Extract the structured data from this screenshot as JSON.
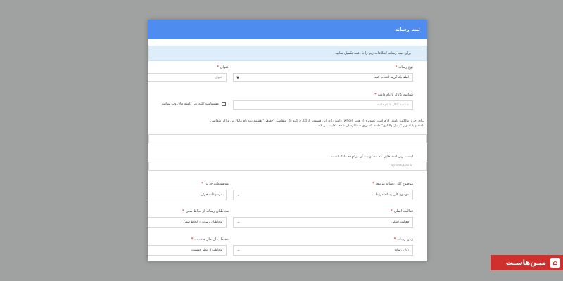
{
  "modal": {
    "title": "ثبت رسانه",
    "alert": "برای ثبت رسانه اطلاعات زیر را با دقت تکمیل نمایید"
  },
  "form": {
    "media_type_label": "نوع رسانه",
    "media_type_value": "لطفا یک گزینه انتخاب کنید",
    "title_label": "عنوان",
    "title_placeholder": "عنوان",
    "channel_id_label": "شناسه کانال یا نام دامنه",
    "channel_id_placeholder": "شناسه کانال یا نام دامنه",
    "subdomain_checkbox_label": "مسئولیت کلیه زیر دامنه های وب سایت",
    "ownership_note_line1": "برای احراز مالکیت دامنه، لازم است تصویری از هویز whois| دامنه را در این قسمت بارگذاری کنید اگر متقاضی \"حقیقی\" هستید باید نام مالک پنل و اگر متقاضی",
    "ownership_note_line2": "دامنه و یا تصویر \"ایمیل والتاری\" دامنه که برای شما ارسال شده، کفایت می کند.",
    "subdomains_label": "لیست زیردامنه هایی که مسئولیت آن برعهده مالک است",
    "subdomains_placeholder": "aparande\\n.ir",
    "main_topic_label": "موضوع کلی رسانه مرتبط",
    "main_topic_value": "موضوع کلی رسانه مرتبط",
    "sub_topics_label": "موضوعات جزئی",
    "sub_topics_value": "موضوعات جزئی",
    "main_activity_label": "فعالیت اصلی",
    "main_activity_value": "فعالیت اصلی",
    "audience_label": "مخاطبان رسانه از لحاظ سنی",
    "audience_value": "مخاطبان رسانه از لحاظ سنی",
    "language_label": "زبان رسانه",
    "language_value": "زبان رسانه",
    "gender_label": "مخاطب از نظر جنسیت",
    "gender_value": "مخاطب از نظر جنسیت"
  },
  "brand": {
    "name": "میـن‌هاسـت"
  },
  "colors": {
    "header": "#4e8cf0",
    "required": "#e0453a",
    "brand": "#d0302d"
  }
}
